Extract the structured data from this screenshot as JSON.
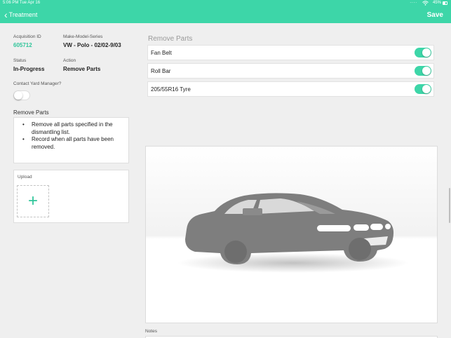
{
  "status_bar": {
    "time_date": "5:06 PM   Tue Apr 16",
    "signal_dots": "....",
    "battery": "45%"
  },
  "navbar": {
    "back_label": "Treatment",
    "save_label": "Save"
  },
  "details": {
    "acquisition_id_label": "Acquisition ID",
    "acquisition_id": "605712",
    "mms_label": "Make-Model-Series",
    "mms": "VW - Polo - 02/02-9/03",
    "status_label": "Status",
    "status": "In-Progress",
    "action_label": "Action",
    "action": "Remove Parts",
    "contact_label": "Contact Yard Manager?",
    "contact_on": false
  },
  "instructions": {
    "title": "Remove Parts",
    "items": [
      "Remove all parts specified in the dismantling list.",
      "Record when all parts have been removed."
    ]
  },
  "upload": {
    "label": "Upload"
  },
  "remove_parts": {
    "header": "Remove Parts",
    "parts": [
      {
        "name": "Fan Belt",
        "removed": true
      },
      {
        "name": "Roll Bar",
        "removed": true
      },
      {
        "name": "205/55R16 Tyre",
        "removed": true
      }
    ]
  },
  "notes": {
    "label": "Notes"
  },
  "colors": {
    "accent": "#3dd6a8",
    "accent_text": "#2fc59a"
  }
}
